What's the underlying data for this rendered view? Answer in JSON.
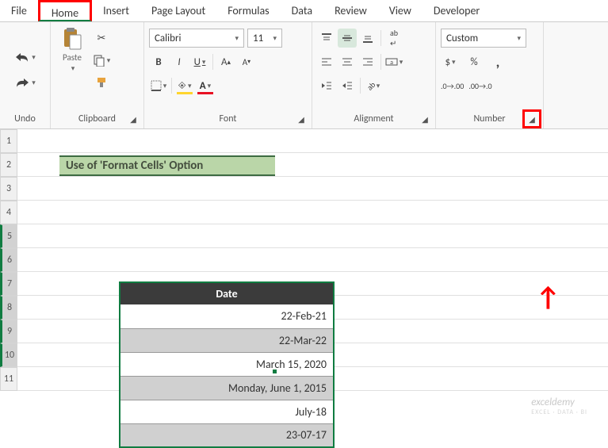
{
  "tabs": {
    "file": "File",
    "home": "Home",
    "insert": "Insert",
    "page_layout": "Page Layout",
    "formulas": "Formulas",
    "data": "Data",
    "review": "Review",
    "view": "View",
    "developer": "Developer"
  },
  "ribbon": {
    "undo_label": "Undo",
    "clipboard_label": "Clipboard",
    "paste_label": "Paste",
    "font_label": "Font",
    "font_name": "Calibri",
    "font_size": "11",
    "bold": "B",
    "italic": "I",
    "underline": "U",
    "alignment_label": "Alignment",
    "number_label": "Number",
    "number_format": "Custom",
    "currency": "$",
    "percent": "%",
    "comma": ","
  },
  "banner": "Use of 'Format Cells' Option",
  "table_header": "Date",
  "rows": [
    "1",
    "2",
    "3",
    "4",
    "5",
    "6",
    "7",
    "8",
    "9",
    "10",
    "11"
  ],
  "selected_rows": [
    "5",
    "6",
    "7",
    "8",
    "9",
    "10"
  ],
  "dates": [
    "22-Feb-21",
    "22-Mar-22",
    "March 15, 2020",
    "Monday, June 1, 2015",
    "July-18",
    "23-07-17"
  ],
  "watermark": {
    "brand": "exceldemy",
    "tag": "EXCEL · DATA · BI"
  },
  "chart_data": {
    "type": "table",
    "title": "Use of 'Format Cells' Option",
    "columns": [
      "Date"
    ],
    "values": [
      "22-Feb-21",
      "22-Mar-22",
      "March 15, 2020",
      "Monday, June 1, 2015",
      "July-18",
      "23-07-17"
    ],
    "number_format": "Custom"
  }
}
